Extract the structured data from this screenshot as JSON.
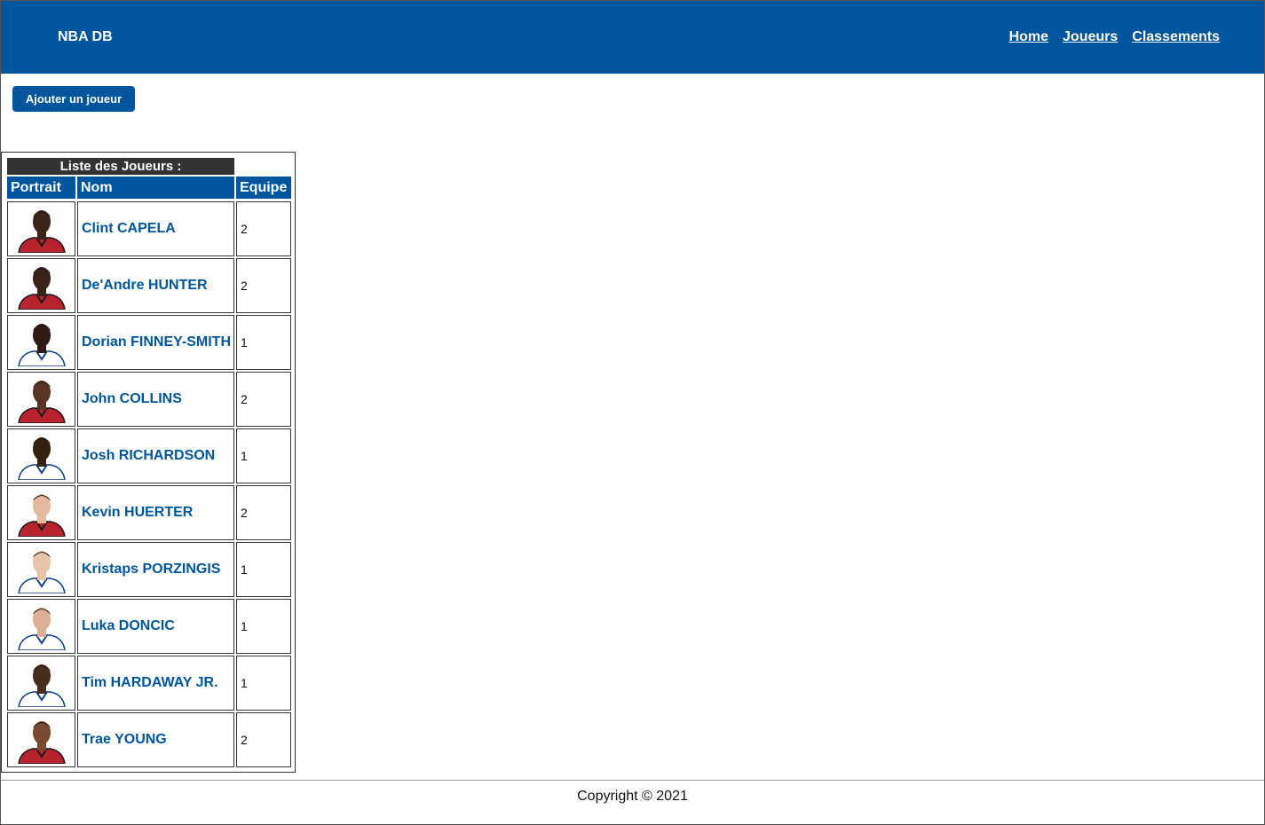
{
  "header": {
    "brand": "NBA DB",
    "nav": [
      {
        "label": "Home"
      },
      {
        "label": "Joueurs"
      },
      {
        "label": "Classements"
      }
    ]
  },
  "actions": {
    "add_player_label": "Ajouter un joueur"
  },
  "players_table": {
    "caption": "Liste des Joueurs :",
    "columns": [
      "Portrait",
      "Nom",
      "Equipe"
    ],
    "rows": [
      {
        "name": "Clint CAPELA",
        "team": "2",
        "jersey": "atlanta",
        "skin": "#3b2418"
      },
      {
        "name": "De'Andre HUNTER",
        "team": "2",
        "jersey": "atlanta",
        "skin": "#3a2317"
      },
      {
        "name": "Dorian FINNEY-SMITH",
        "team": "1",
        "jersey": "dallas",
        "skin": "#2e1b12"
      },
      {
        "name": "John COLLINS",
        "team": "2",
        "jersey": "atlanta",
        "skin": "#5a3524"
      },
      {
        "name": "Josh RICHARDSON",
        "team": "1",
        "jersey": "dallas",
        "skin": "#33200f"
      },
      {
        "name": "Kevin HUERTER",
        "team": "2",
        "jersey": "atlanta",
        "skin": "#e4b99c"
      },
      {
        "name": "Kristaps PORZINGIS",
        "team": "1",
        "jersey": "dallas",
        "skin": "#e9c3a8"
      },
      {
        "name": "Luka DONCIC",
        "team": "1",
        "jersey": "dallas",
        "skin": "#dcb092"
      },
      {
        "name": "Tim HARDAWAY JR.",
        "team": "1",
        "jersey": "dallas",
        "skin": "#4a2c1c"
      },
      {
        "name": "Trae YOUNG",
        "team": "2",
        "jersey": "atlanta",
        "skin": "#7a4a30"
      }
    ]
  },
  "colors": {
    "primary": "#00569e",
    "caption_bg": "#333333",
    "atlanta_jersey": "#b8232f",
    "dallas_jersey": "#ffffff"
  },
  "footer": {
    "copyright": "Copyright © 2021"
  }
}
